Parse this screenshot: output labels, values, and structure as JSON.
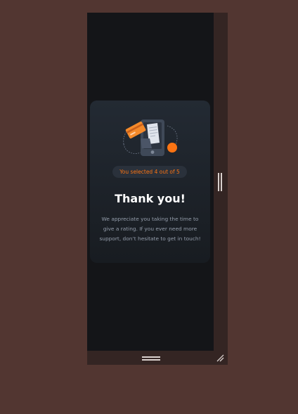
{
  "rating": {
    "selected_text": "You selected 4 out of 5",
    "selected_value": 4,
    "max_value": 5
  },
  "thanks": {
    "title": "Thank you!",
    "message": "We appreciate you taking the time to give a rating. If you ever need more support, don’t hesitate to get in touch!"
  },
  "icons": {
    "illustration": "phone-with-card-and-receipt-illustration",
    "vertical_resize": "vertical-resize-grip-icon",
    "horizontal_resize": "horizontal-resize-grip-icon",
    "corner_resize": "corner-resize-grip-icon"
  },
  "colors": {
    "page_background": "#523631",
    "frame": "#342523",
    "viewport": "#141518",
    "card_top": "#232a33",
    "card_bottom": "#181c21",
    "accent": "#fb7413",
    "title": "#ffffff",
    "body_text": "#959eac"
  }
}
